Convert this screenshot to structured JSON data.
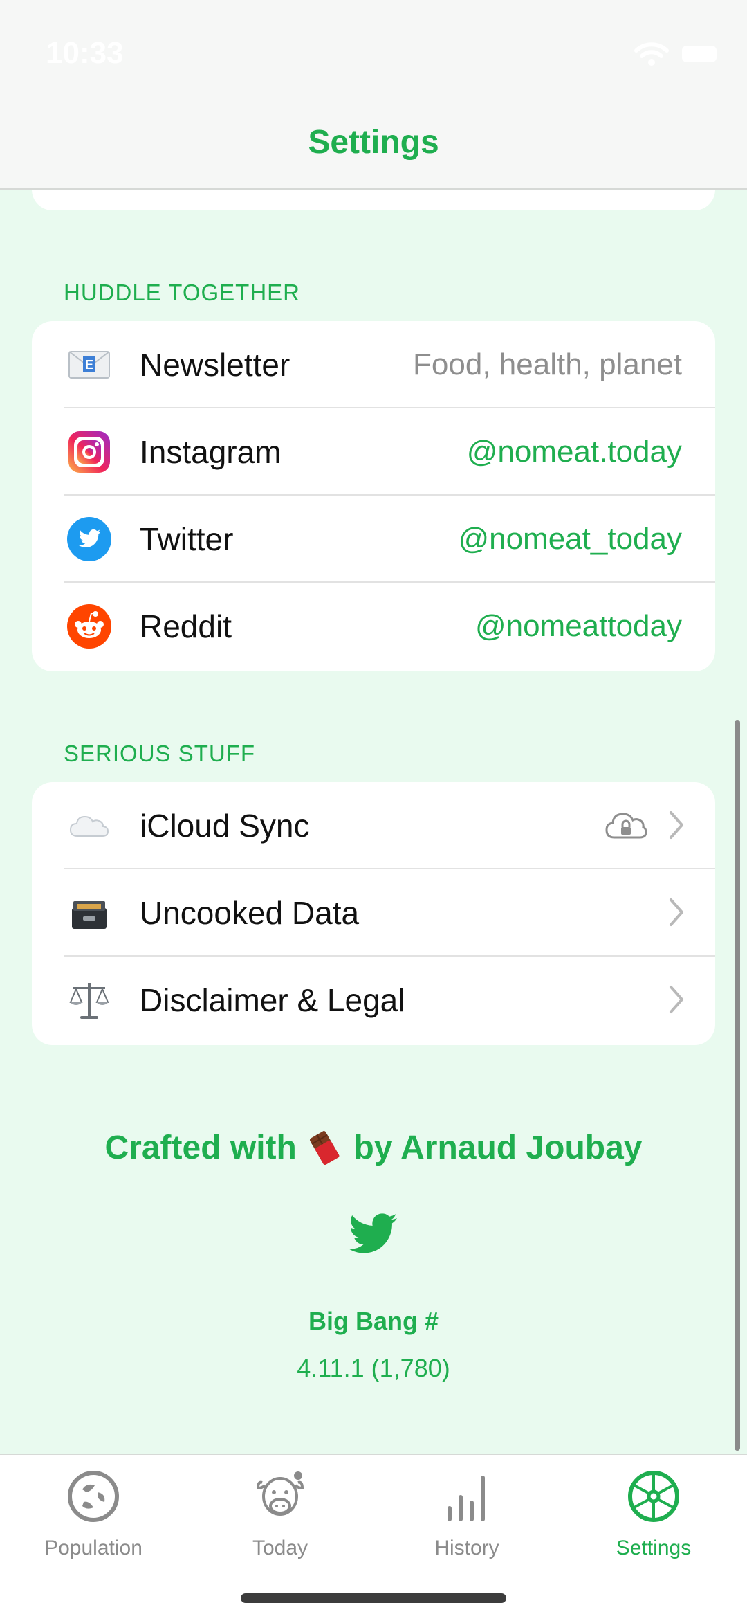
{
  "status_bar": {
    "time": "10:33"
  },
  "nav": {
    "title": "Settings"
  },
  "sections": {
    "huddle": {
      "header": "HUDDLE TOGETHER",
      "rows": [
        {
          "label": "Newsletter",
          "value": "Food, health, planet",
          "icon": "envelope-icon"
        },
        {
          "label": "Instagram",
          "value": "@nomeat.today",
          "icon": "instagram-icon"
        },
        {
          "label": "Twitter",
          "value": "@nomeat_today",
          "icon": "twitter-icon"
        },
        {
          "label": "Reddit",
          "value": "@nomeattoday",
          "icon": "reddit-icon"
        }
      ]
    },
    "serious": {
      "header": "SERIOUS STUFF",
      "rows": [
        {
          "label": "iCloud Sync",
          "icon": "cloud-icon"
        },
        {
          "label": "Uncooked Data",
          "icon": "file-box-icon"
        },
        {
          "label": "Disclaimer & Legal",
          "icon": "scales-icon"
        }
      ]
    }
  },
  "footer": {
    "crafted_prefix": "Crafted with",
    "crafted_suffix": "by Arnaud Joubay",
    "big_bang": "Big Bang #",
    "version": "4.11.1 (1,780)"
  },
  "tabs": [
    {
      "label": "Population",
      "icon": "population-icon",
      "active": false
    },
    {
      "label": "Today",
      "icon": "cow-icon",
      "active": false
    },
    {
      "label": "History",
      "icon": "bar-chart-icon",
      "active": false
    },
    {
      "label": "Settings",
      "icon": "wheel-icon",
      "active": true
    }
  ],
  "colors": {
    "accent": "#1fae4f",
    "background": "#e9faef"
  }
}
